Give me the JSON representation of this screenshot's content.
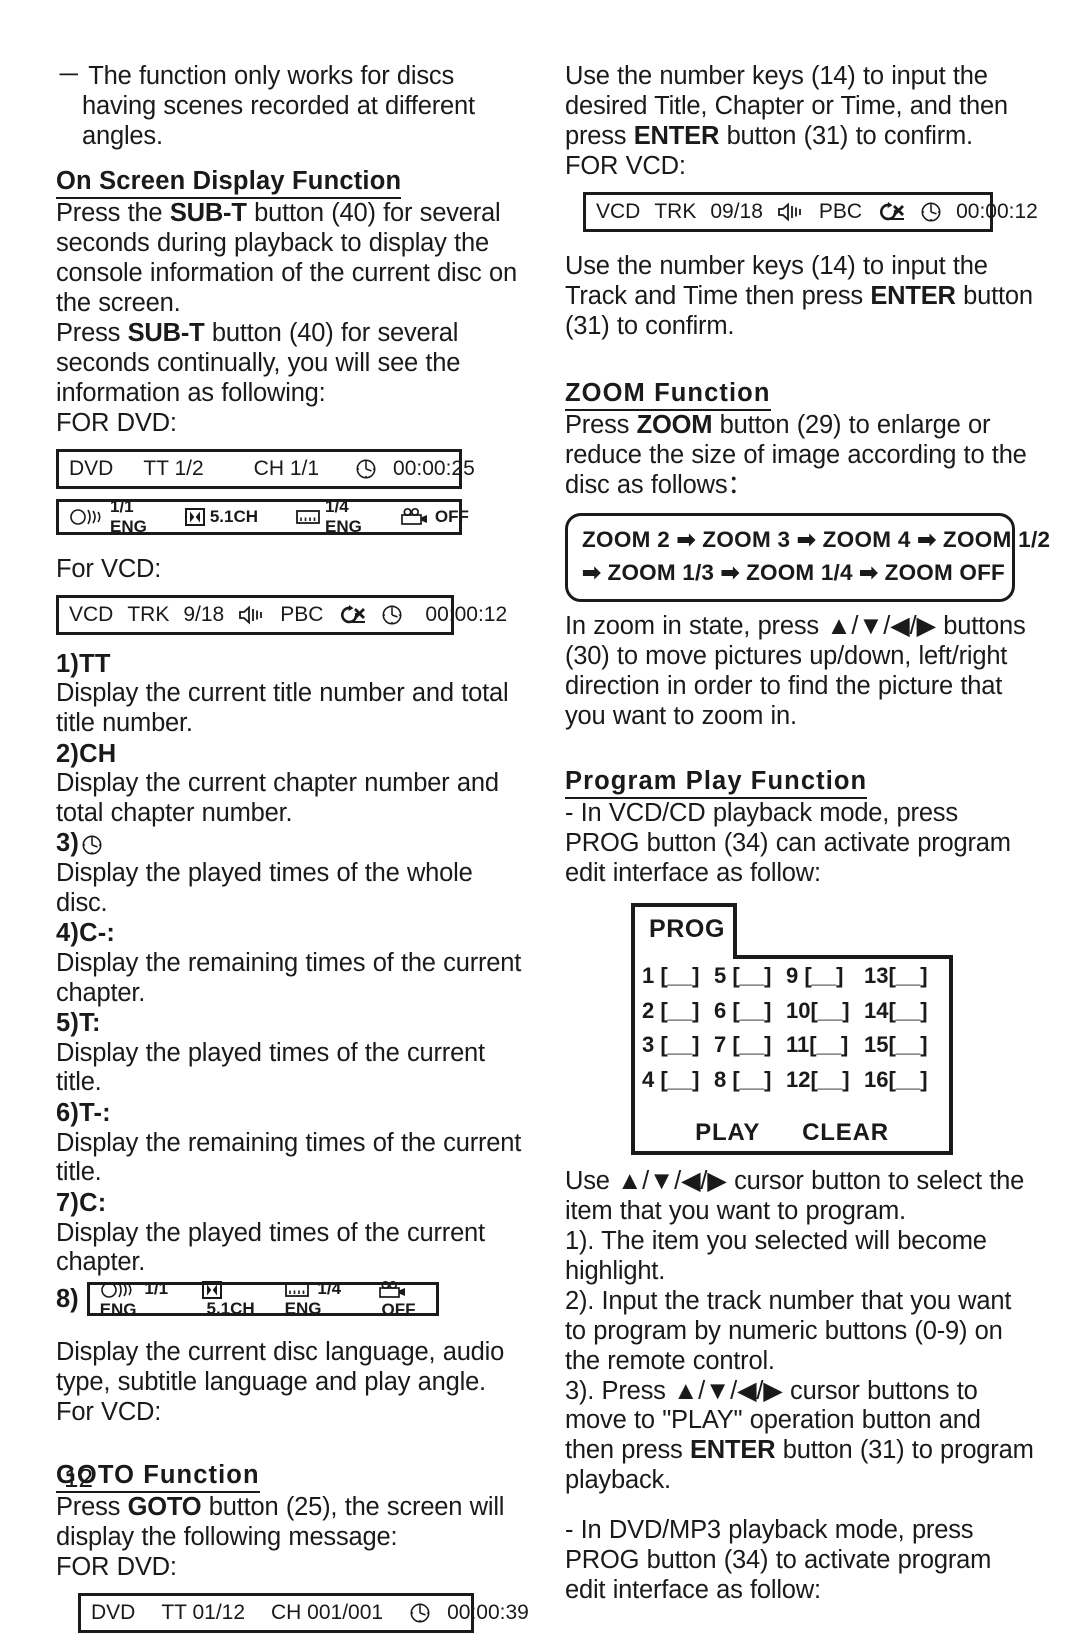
{
  "page": {
    "number": "12"
  },
  "left_column": {
    "intro_note": "－  The function only works for discs having scenes recorded at different angles.",
    "osd_heading": "On Screen Display Function",
    "osd_para1_a": "Press the ",
    "osd_para1_b": "SUB-T",
    "osd_para1_c": " button (40) for several seconds during playback to display the console information of the current disc on the screen.",
    "osd_para2_a": "Press ",
    "osd_para2_b": "SUB-T",
    "osd_para2_c": " button (40) for several seconds continually, you will see the information as following:",
    "for_dvd_label": "FOR DVD:",
    "for_vcd_label": "For VCD:",
    "osd_dvd_box": {
      "disc": "DVD",
      "title": "TT 1/2",
      "chapter": "CH 1/1",
      "clock_icon": "clock-icon",
      "time": "00:00:25"
    },
    "osd_lang_box": {
      "audio_icon": "audio-speaker-icon",
      "audio": "1/1 ENG",
      "dolby_icon": "dolby-digital-icon",
      "channels": "5.1CH",
      "subtitle_icon": "subtitle-icon",
      "subtitle": "1/4 ENG",
      "angle_icon": "camera-angle-icon",
      "angle": "OFF"
    },
    "osd_vcd_box": {
      "disc": "VCD",
      "trk_label": "TRK",
      "track": "9/18",
      "speaker_icon": "speaker-icon",
      "pbc": "PBC",
      "repeat_icon": "repeat-off-icon",
      "clock_icon": "clock-icon",
      "time": "00:00:12"
    },
    "items": [
      {
        "num": "1)TT",
        "desc": "Display the current title number and total title number."
      },
      {
        "num": "2)CH",
        "desc": "Display the current chapter number and total chapter number."
      },
      {
        "num": "3)",
        "icon": "clock-icon",
        "desc": "Display the played times of the whole disc."
      },
      {
        "num": "4)C-:",
        "desc": "Display the remaining times of the current chapter."
      },
      {
        "num": "5)T:",
        "desc": "Display the played times of the current title."
      },
      {
        "num": "6)T-:",
        "desc": "Display the remaining times of the current title."
      },
      {
        "num": "7)C:",
        "desc": "Display the played times of the current chapter."
      }
    ],
    "item8_label": "8)",
    "item8_desc": "Display the current disc language, audio type, subtitle language and play angle.",
    "item8_forvcd": "For VCD:",
    "goto_heading": "GOTO Function",
    "goto_para_a": "Press ",
    "goto_para_b": "GOTO",
    "goto_para_c": " button (25), the screen will display the following message:",
    "goto_for_dvd": "FOR DVD:",
    "goto_dvd_box": {
      "disc": "DVD",
      "title": "TT 01/12",
      "chapter": "CH 001/001",
      "clock_icon": "clock-icon",
      "time": "00:00:39"
    }
  },
  "right_column": {
    "para1_a": "Use the number keys (14) to input the desired Title, Chapter or Time, and then press ",
    "para1_b": "ENTER",
    "para1_c": " button (31) to confirm.",
    "for_vcd_label": "FOR VCD:",
    "osd_vcd_box": {
      "disc": "VCD",
      "trk_label": "TRK",
      "track": "09/18",
      "speaker_icon": "speaker-icon",
      "pbc": "PBC",
      "repeat_icon": "repeat-off-icon",
      "clock_icon": "clock-icon",
      "time": "00:00:12"
    },
    "para2_a": "Use the number keys (14) to input the Track and Time then press ",
    "para2_b": "ENTER",
    "para2_c": " button (31) to confirm.",
    "zoom_heading": "ZOOM Function",
    "zoom_para_a": "Press ",
    "zoom_para_b": "ZOOM",
    "zoom_para_c": " button (29) to enlarge or reduce the size of image according to the disc as follows：",
    "zoom_box_line1": "ZOOM 2 ➡ ZOOM 3 ➡ ZOOM 4 ➡ ZOOM 1/2",
    "zoom_box_line2": "➡ ZOOM 1/3 ➡ ZOOM 1/4 ➡ ZOOM OFF",
    "zoom_after_para": "In  zoom in state, press  ▲/▼/◀/▶ buttons (30) to move pictures up/down, left/right direction in order to find the picture that you want to zoom in.",
    "program_heading": "Program  Play  Function",
    "program_para1": "- In VCD/CD playback mode, press PROG button (34) can activate program edit interface as follow:",
    "prog_panel": {
      "tab_label": "PROG",
      "rows": [
        [
          "1 [__]",
          "5 [__]",
          "9 [__]",
          "13[__]"
        ],
        [
          "2 [__]",
          "6 [__]",
          "10[__]",
          "14[__]"
        ],
        [
          "3 [__]",
          "7 [__]",
          "11[__]",
          "15[__]"
        ],
        [
          "4 [__]",
          "8 [__]",
          "12[__]",
          "16[__]"
        ]
      ],
      "play_label": "PLAY",
      "clear_label": "CLEAR"
    },
    "program_use_para": "Use ▲/▼/◀/▶ cursor button to select the item that you want to program.",
    "program_step1": "1).  The item you selected will become highlight.",
    "program_step2": "2).  Input the track number that you want to program by numeric buttons (0-9) on the remote control.",
    "program_step3_a": "3).  Press ▲/▼/◀/▶ cursor buttons to move to \"PLAY\" operation button and then press ",
    "program_step3_b": "ENTER",
    "program_step3_c": " button (31) to program playback.",
    "program_para_last": "-  In DVD/MP3 playback mode, press PROG button (34) to activate program edit interface as follow:"
  },
  "colors": {
    "ink": "#1a1a1a",
    "paper": "#ffffff"
  }
}
